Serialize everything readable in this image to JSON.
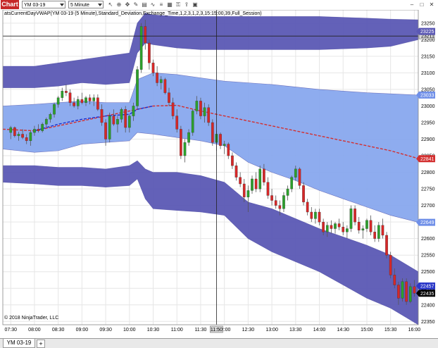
{
  "toolbar": {
    "chart_tab": "Chart",
    "instrument": "YM 03-19",
    "interval": "5 Minute",
    "icons": [
      "cursor-icon",
      "zoom-icon",
      "pan-icon",
      "drawing-icon",
      "strategy-icon",
      "indicator-icon",
      "properties-icon",
      "data-box-icon",
      "lock-icon",
      "share-icon",
      "screenshot-icon"
    ]
  },
  "window_controls": [
    "minimize-icon",
    "maximize-icon",
    "close-icon"
  ],
  "indicator_label": "atsCurrentDayVWAP(YM 03-19 (5 Minute),Standard_Deviation,Exchange_Time,1,2,3,1,2,3,15:15:00,39,Full_Session)",
  "copyright": "© 2018 NinjaTrader, LLC",
  "crosshair": {
    "time_label": "11:50",
    "price_label": "23211"
  },
  "badges": {
    "upper_band_3": {
      "value": "23225",
      "color": "#5b58b4"
    },
    "upper_band_2": {
      "value": "23033",
      "color": "#6f8fe8"
    },
    "vwap": {
      "value": "22841",
      "color": "#d32f2f"
    },
    "lower_band_2": {
      "value": "22649",
      "color": "#6f8fe8"
    },
    "lower_band_3": {
      "value": "22457",
      "color": "#2b38c8"
    },
    "last_price": {
      "value": "22435",
      "color": "#000000"
    }
  },
  "bottom_tabs": {
    "active": "YM 03-19",
    "add": "+"
  },
  "colors": {
    "outer_band": "#5b58b4",
    "inner_band": "#88a8ee",
    "vwap_line": "#d32f2f",
    "vwap_line_early": "#1a2ed0",
    "candle_up": "#2ca02c",
    "candle_down": "#d62728",
    "wick": "#555555"
  },
  "chart_data": {
    "type": "candlestick",
    "x_labels": [
      "07:30",
      "08:00",
      "08:30",
      "09:00",
      "09:30",
      "10:00",
      "10:30",
      "11:00",
      "11:30",
      "12:00",
      "12:30",
      "13:00",
      "13:30",
      "14:00",
      "14:30",
      "15:00",
      "15:30",
      "16:00"
    ],
    "y_labels": [
      "23250",
      "23200",
      "23150",
      "23100",
      "23050",
      "23000",
      "22950",
      "22900",
      "22850",
      "22800",
      "22750",
      "22700",
      "22650",
      "22600",
      "22550",
      "22500",
      "22450",
      "22400",
      "22350"
    ],
    "ylim": [
      22340,
      23290
    ],
    "time_range": [
      "07:20",
      "16:05"
    ],
    "bar_interval_minutes": 5,
    "candles": [
      {
        "t": "07:30",
        "o": 22920,
        "h": 22940,
        "l": 22900,
        "c": 22935
      },
      {
        "t": "07:35",
        "o": 22935,
        "h": 22938,
        "l": 22905,
        "c": 22910
      },
      {
        "t": "07:40",
        "o": 22910,
        "h": 22922,
        "l": 22895,
        "c": 22915
      },
      {
        "t": "07:45",
        "o": 22915,
        "h": 22930,
        "l": 22900,
        "c": 22905
      },
      {
        "t": "07:50",
        "o": 22905,
        "h": 22915,
        "l": 22885,
        "c": 22895
      },
      {
        "t": "07:55",
        "o": 22895,
        "h": 22925,
        "l": 22880,
        "c": 22920
      },
      {
        "t": "08:00",
        "o": 22920,
        "h": 22940,
        "l": 22910,
        "c": 22930
      },
      {
        "t": "08:05",
        "o": 22930,
        "h": 22945,
        "l": 22920,
        "c": 22925
      },
      {
        "t": "08:10",
        "o": 22925,
        "h": 22950,
        "l": 22920,
        "c": 22945
      },
      {
        "t": "08:15",
        "o": 22945,
        "h": 22965,
        "l": 22935,
        "c": 22960
      },
      {
        "t": "08:20",
        "o": 22960,
        "h": 22980,
        "l": 22950,
        "c": 22975
      },
      {
        "t": "08:25",
        "o": 22975,
        "h": 23010,
        "l": 22965,
        "c": 23005
      },
      {
        "t": "08:30",
        "o": 23005,
        "h": 23030,
        "l": 22995,
        "c": 23025
      },
      {
        "t": "08:35",
        "o": 23025,
        "h": 23055,
        "l": 23015,
        "c": 23045
      },
      {
        "t": "08:40",
        "o": 23045,
        "h": 23065,
        "l": 23030,
        "c": 23040
      },
      {
        "t": "08:45",
        "o": 23040,
        "h": 23050,
        "l": 23000,
        "c": 23010
      },
      {
        "t": "08:50",
        "o": 23010,
        "h": 23025,
        "l": 22995,
        "c": 23000
      },
      {
        "t": "08:55",
        "o": 23000,
        "h": 23030,
        "l": 22990,
        "c": 23020
      },
      {
        "t": "09:00",
        "o": 23020,
        "h": 23040,
        "l": 23005,
        "c": 23010
      },
      {
        "t": "09:05",
        "o": 23010,
        "h": 23030,
        "l": 23000,
        "c": 23025
      },
      {
        "t": "09:10",
        "o": 23025,
        "h": 23035,
        "l": 23005,
        "c": 23015
      },
      {
        "t": "09:15",
        "o": 23015,
        "h": 23035,
        "l": 23000,
        "c": 23025
      },
      {
        "t": "09:20",
        "o": 23025,
        "h": 23035,
        "l": 22985,
        "c": 22990
      },
      {
        "t": "09:25",
        "o": 22990,
        "h": 23005,
        "l": 22940,
        "c": 22950
      },
      {
        "t": "09:30",
        "o": 22950,
        "h": 22960,
        "l": 22880,
        "c": 22900
      },
      {
        "t": "09:35",
        "o": 22900,
        "h": 22980,
        "l": 22890,
        "c": 22970
      },
      {
        "t": "09:40",
        "o": 22970,
        "h": 22990,
        "l": 22940,
        "c": 22945
      },
      {
        "t": "09:45",
        "o": 22945,
        "h": 22970,
        "l": 22920,
        "c": 22960
      },
      {
        "t": "09:50",
        "o": 22960,
        "h": 22995,
        "l": 22950,
        "c": 22990
      },
      {
        "t": "09:55",
        "o": 22990,
        "h": 23000,
        "l": 22920,
        "c": 22935
      },
      {
        "t": "10:00",
        "o": 22935,
        "h": 22975,
        "l": 22920,
        "c": 22970
      },
      {
        "t": "10:05",
        "o": 22970,
        "h": 23010,
        "l": 22955,
        "c": 23000
      },
      {
        "t": "10:10",
        "o": 23000,
        "h": 23120,
        "l": 22990,
        "c": 23110
      },
      {
        "t": "10:15",
        "o": 23110,
        "h": 23250,
        "l": 23100,
        "c": 23240
      },
      {
        "t": "10:20",
        "o": 23240,
        "h": 23260,
        "l": 23170,
        "c": 23190
      },
      {
        "t": "10:25",
        "o": 23190,
        "h": 23200,
        "l": 23110,
        "c": 23130
      },
      {
        "t": "10:30",
        "o": 23130,
        "h": 23140,
        "l": 23090,
        "c": 23100
      },
      {
        "t": "10:35",
        "o": 23100,
        "h": 23120,
        "l": 23060,
        "c": 23070
      },
      {
        "t": "10:40",
        "o": 23070,
        "h": 23090,
        "l": 23050,
        "c": 23080
      },
      {
        "t": "10:45",
        "o": 23080,
        "h": 23085,
        "l": 23035,
        "c": 23040
      },
      {
        "t": "10:50",
        "o": 23040,
        "h": 23055,
        "l": 23000,
        "c": 23010
      },
      {
        "t": "10:55",
        "o": 23010,
        "h": 23025,
        "l": 22960,
        "c": 22970
      },
      {
        "t": "11:00",
        "o": 22970,
        "h": 22990,
        "l": 22920,
        "c": 22930
      },
      {
        "t": "11:05",
        "o": 22930,
        "h": 22940,
        "l": 22840,
        "c": 22850
      },
      {
        "t": "11:10",
        "o": 22850,
        "h": 22900,
        "l": 22830,
        "c": 22890
      },
      {
        "t": "11:15",
        "o": 22890,
        "h": 22930,
        "l": 22880,
        "c": 22920
      },
      {
        "t": "11:20",
        "o": 22920,
        "h": 22990,
        "l": 22910,
        "c": 22985
      },
      {
        "t": "11:25",
        "o": 22985,
        "h": 23030,
        "l": 22975,
        "c": 23015
      },
      {
        "t": "11:30",
        "o": 23015,
        "h": 23025,
        "l": 22960,
        "c": 22970
      },
      {
        "t": "11:35",
        "o": 22970,
        "h": 23010,
        "l": 22950,
        "c": 22995
      },
      {
        "t": "11:40",
        "o": 22995,
        "h": 23005,
        "l": 22940,
        "c": 22950
      },
      {
        "t": "11:45",
        "o": 22950,
        "h": 22960,
        "l": 22880,
        "c": 22890
      },
      {
        "t": "11:50",
        "o": 22890,
        "h": 22925,
        "l": 22865,
        "c": 22915
      },
      {
        "t": "11:55",
        "o": 22915,
        "h": 22920,
        "l": 22870,
        "c": 22880
      },
      {
        "t": "12:00",
        "o": 22880,
        "h": 22895,
        "l": 22855,
        "c": 22885
      },
      {
        "t": "12:05",
        "o": 22885,
        "h": 22890,
        "l": 22840,
        "c": 22850
      },
      {
        "t": "12:10",
        "o": 22850,
        "h": 22860,
        "l": 22810,
        "c": 22820
      },
      {
        "t": "12:15",
        "o": 22820,
        "h": 22830,
        "l": 22775,
        "c": 22785
      },
      {
        "t": "12:20",
        "o": 22785,
        "h": 22800,
        "l": 22755,
        "c": 22765
      },
      {
        "t": "12:25",
        "o": 22765,
        "h": 22780,
        "l": 22710,
        "c": 22725
      },
      {
        "t": "12:30",
        "o": 22725,
        "h": 22760,
        "l": 22680,
        "c": 22745
      },
      {
        "t": "12:35",
        "o": 22745,
        "h": 22790,
        "l": 22735,
        "c": 22780
      },
      {
        "t": "12:40",
        "o": 22780,
        "h": 22800,
        "l": 22740,
        "c": 22750
      },
      {
        "t": "12:45",
        "o": 22750,
        "h": 22820,
        "l": 22740,
        "c": 22810
      },
      {
        "t": "12:50",
        "o": 22810,
        "h": 22825,
        "l": 22760,
        "c": 22770
      },
      {
        "t": "12:55",
        "o": 22770,
        "h": 22785,
        "l": 22720,
        "c": 22730
      },
      {
        "t": "13:00",
        "o": 22730,
        "h": 22750,
        "l": 22700,
        "c": 22715
      },
      {
        "t": "13:05",
        "o": 22715,
        "h": 22730,
        "l": 22690,
        "c": 22700
      },
      {
        "t": "13:10",
        "o": 22700,
        "h": 22715,
        "l": 22670,
        "c": 22690
      },
      {
        "t": "13:15",
        "o": 22690,
        "h": 22740,
        "l": 22680,
        "c": 22730
      },
      {
        "t": "13:20",
        "o": 22730,
        "h": 22760,
        "l": 22715,
        "c": 22750
      },
      {
        "t": "13:25",
        "o": 22750,
        "h": 22790,
        "l": 22740,
        "c": 22785
      },
      {
        "t": "13:30",
        "o": 22785,
        "h": 22820,
        "l": 22775,
        "c": 22810
      },
      {
        "t": "13:35",
        "o": 22810,
        "h": 22815,
        "l": 22750,
        "c": 22760
      },
      {
        "t": "13:40",
        "o": 22760,
        "h": 22770,
        "l": 22700,
        "c": 22710
      },
      {
        "t": "13:45",
        "o": 22710,
        "h": 22720,
        "l": 22670,
        "c": 22680
      },
      {
        "t": "13:50",
        "o": 22680,
        "h": 22695,
        "l": 22650,
        "c": 22660
      },
      {
        "t": "13:55",
        "o": 22660,
        "h": 22690,
        "l": 22645,
        "c": 22680
      },
      {
        "t": "14:00",
        "o": 22680,
        "h": 22690,
        "l": 22640,
        "c": 22650
      },
      {
        "t": "14:05",
        "o": 22650,
        "h": 22660,
        "l": 22610,
        "c": 22620
      },
      {
        "t": "14:10",
        "o": 22620,
        "h": 22650,
        "l": 22605,
        "c": 22640
      },
      {
        "t": "14:15",
        "o": 22640,
        "h": 22655,
        "l": 22615,
        "c": 22630
      },
      {
        "t": "14:20",
        "o": 22630,
        "h": 22650,
        "l": 22615,
        "c": 22645
      },
      {
        "t": "14:25",
        "o": 22645,
        "h": 22660,
        "l": 22625,
        "c": 22635
      },
      {
        "t": "14:30",
        "o": 22635,
        "h": 22650,
        "l": 22610,
        "c": 22620
      },
      {
        "t": "14:35",
        "o": 22620,
        "h": 22640,
        "l": 22600,
        "c": 22630
      },
      {
        "t": "14:40",
        "o": 22630,
        "h": 22700,
        "l": 22620,
        "c": 22690
      },
      {
        "t": "14:45",
        "o": 22690,
        "h": 22700,
        "l": 22640,
        "c": 22650
      },
      {
        "t": "14:50",
        "o": 22650,
        "h": 22665,
        "l": 22615,
        "c": 22625
      },
      {
        "t": "14:55",
        "o": 22625,
        "h": 22640,
        "l": 22600,
        "c": 22630
      },
      {
        "t": "15:00",
        "o": 22630,
        "h": 22660,
        "l": 22620,
        "c": 22655
      },
      {
        "t": "15:05",
        "o": 22655,
        "h": 22670,
        "l": 22610,
        "c": 22620
      },
      {
        "t": "15:10",
        "o": 22620,
        "h": 22640,
        "l": 22590,
        "c": 22600
      },
      {
        "t": "15:15",
        "o": 22600,
        "h": 22650,
        "l": 22590,
        "c": 22640
      },
      {
        "t": "15:20",
        "o": 22640,
        "h": 22660,
        "l": 22600,
        "c": 22610
      },
      {
        "t": "15:25",
        "o": 22610,
        "h": 22620,
        "l": 22540,
        "c": 22550
      },
      {
        "t": "15:30",
        "o": 22550,
        "h": 22560,
        "l": 22480,
        "c": 22490
      },
      {
        "t": "15:35",
        "o": 22490,
        "h": 22510,
        "l": 22450,
        "c": 22460
      },
      {
        "t": "15:40",
        "o": 22460,
        "h": 22470,
        "l": 22400,
        "c": 22420
      },
      {
        "t": "15:45",
        "o": 22420,
        "h": 22480,
        "l": 22410,
        "c": 22470
      },
      {
        "t": "15:50",
        "o": 22470,
        "h": 22480,
        "l": 22400,
        "c": 22410
      },
      {
        "t": "15:55",
        "o": 22410,
        "h": 22465,
        "l": 22405,
        "c": 22455
      },
      {
        "t": "16:00",
        "o": 22455,
        "h": 22475,
        "l": 22425,
        "c": 22435
      }
    ],
    "vwap": {
      "x": [
        "07:20",
        "08:00",
        "08:30",
        "09:00",
        "09:30",
        "10:00",
        "10:10",
        "10:30",
        "11:00",
        "11:30",
        "12:00",
        "13:00",
        "14:00",
        "15:00",
        "15:30",
        "16:00",
        "16:05"
      ],
      "y": [
        22930,
        22925,
        22945,
        22960,
        22970,
        22975,
        22990,
        23000,
        23002,
        22985,
        22970,
        22940,
        22910,
        22880,
        22865,
        22845,
        22841
      ]
    },
    "upper_band_1": {
      "x": [
        "07:20",
        "08:00",
        "08:30",
        "09:00",
        "09:30",
        "10:00",
        "10:10",
        "10:30",
        "11:00",
        "11:30",
        "12:00",
        "13:00",
        "14:00",
        "15:00",
        "16:05"
      ],
      "y": [
        23000,
        23005,
        23010,
        23015,
        23010,
        23010,
        23080,
        23100,
        23095,
        23085,
        23075,
        23065,
        23050,
        23040,
        23033
      ]
    },
    "upper_band_2": {
      "x": [
        "07:20",
        "08:00",
        "08:30",
        "09:00",
        "09:30",
        "10:00",
        "10:10",
        "10:30",
        "11:00",
        "11:30",
        "12:00",
        "13:00",
        "14:00",
        "15:00",
        "16:05"
      ],
      "y": [
        23000,
        23005,
        23010,
        23015,
        23010,
        23010,
        23080,
        23100,
        23095,
        23085,
        23075,
        23065,
        23050,
        23040,
        23033
      ]
    },
    "lower_band_2": {
      "x": [
        "07:20",
        "08:00",
        "08:30",
        "09:00",
        "09:30",
        "10:00",
        "10:10",
        "10:30",
        "11:00",
        "11:30",
        "12:00",
        "12:30",
        "13:00",
        "13:30",
        "14:00",
        "14:30",
        "15:00",
        "15:30",
        "16:05"
      ],
      "y": [
        22870,
        22860,
        22865,
        22885,
        22890,
        22895,
        22920,
        22915,
        22905,
        22895,
        22880,
        22830,
        22800,
        22775,
        22745,
        22720,
        22695,
        22670,
        22649
      ]
    },
    "upper_band_3_top": {
      "x": [
        "07:20",
        "08:00",
        "08:30",
        "09:00",
        "09:30",
        "10:00",
        "10:10",
        "10:20",
        "10:30",
        "11:00",
        "11:30",
        "12:00",
        "13:00",
        "14:00",
        "15:00",
        "15:30",
        "16:05"
      ],
      "y": [
        23120,
        23120,
        23130,
        23140,
        23150,
        23160,
        23250,
        23280,
        23275,
        23270,
        23270,
        23270,
        23270,
        23270,
        23265,
        23262,
        23260
      ]
    },
    "upper_band_3_bottom": {
      "x": [
        "07:20",
        "08:00",
        "08:30",
        "09:00",
        "09:30",
        "10:00",
        "10:10",
        "10:20",
        "10:30",
        "11:00",
        "11:30",
        "12:00",
        "13:00",
        "14:00",
        "15:00",
        "15:30",
        "16:05"
      ],
      "y": [
        23055,
        23055,
        23060,
        23070,
        23065,
        23070,
        23160,
        23190,
        23185,
        23175,
        23170,
        23170,
        23170,
        23170,
        23175,
        23180,
        23200
      ]
    },
    "lower_band_3_top": {
      "x": [
        "07:20",
        "08:00",
        "08:30",
        "09:00",
        "09:30",
        "10:00",
        "10:10",
        "10:20",
        "10:30",
        "11:00",
        "11:30",
        "12:00",
        "12:30",
        "13:00",
        "13:30",
        "14:00",
        "14:30",
        "15:00",
        "15:30",
        "16:05"
      ],
      "y": [
        22820,
        22820,
        22815,
        22815,
        22810,
        22820,
        22835,
        22810,
        22800,
        22800,
        22790,
        22770,
        22710,
        22690,
        22660,
        22630,
        22605,
        22580,
        22550,
        22500
      ]
    },
    "lower_band_3_bottom": {
      "x": [
        "07:20",
        "08:00",
        "08:30",
        "09:00",
        "09:30",
        "10:00",
        "10:10",
        "10:20",
        "10:30",
        "11:00",
        "11:30",
        "12:00",
        "12:30",
        "13:00",
        "13:30",
        "14:00",
        "14:30",
        "15:00",
        "15:30",
        "16:05"
      ],
      "y": [
        22770,
        22765,
        22760,
        22760,
        22755,
        22760,
        22780,
        22720,
        22690,
        22685,
        22680,
        22670,
        22600,
        22560,
        22530,
        22500,
        22460,
        22420,
        22390,
        22340
      ]
    }
  }
}
